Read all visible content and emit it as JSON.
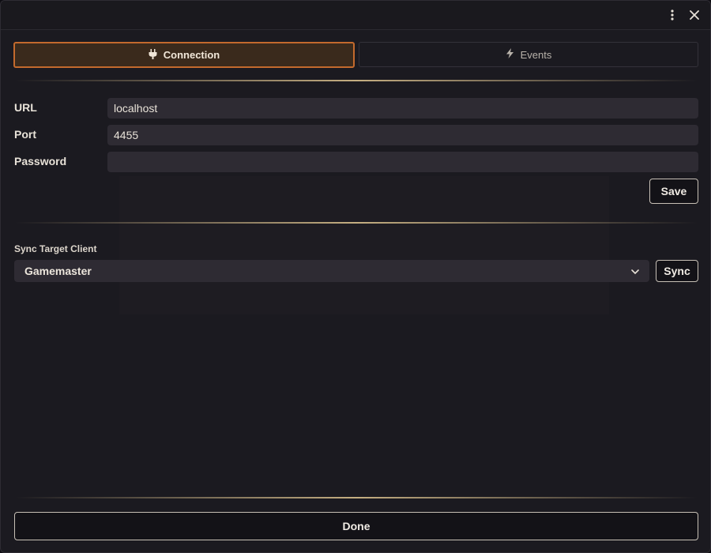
{
  "window": {
    "more_icon": "vertical-ellipsis-icon",
    "close_icon": "close-icon"
  },
  "tabs": [
    {
      "label": "Connection",
      "icon": "plug-icon",
      "active": true
    },
    {
      "label": "Events",
      "icon": "lightning-bolt-icon",
      "active": false
    }
  ],
  "connection": {
    "url_label": "URL",
    "url_value": "localhost",
    "port_label": "Port",
    "port_value": "4455",
    "password_label": "Password",
    "password_value": "",
    "save_label": "Save"
  },
  "sync": {
    "label": "Sync Target Client",
    "selected": "Gamemaster",
    "sync_label": "Sync"
  },
  "footer": {
    "done_label": "Done"
  },
  "colors": {
    "accent": "#c36a2d",
    "background": "#1b1a20",
    "field": "#2e2b33"
  }
}
